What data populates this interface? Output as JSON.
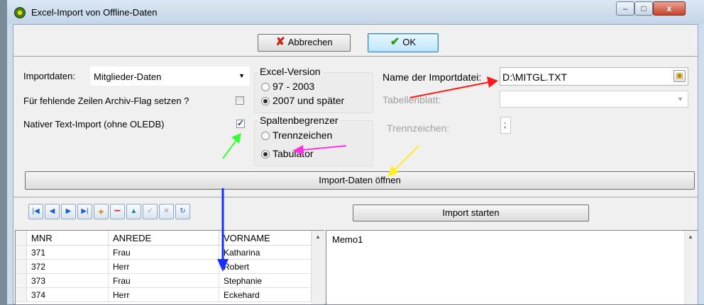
{
  "window": {
    "title": "Excel-Import von Offline-Daten",
    "minimize": "–",
    "maximize": "□",
    "close": "x"
  },
  "toolbar": {
    "cancel_label": "Abbrechen",
    "ok_label": "OK"
  },
  "import": {
    "label": "Importdaten:",
    "selected": "Mitglieder-Daten",
    "archive_flag_label": "Für fehlende Zeilen Archiv-Flag setzen ?",
    "archive_flag_checked": false,
    "native_import_label": "Nativer Text-Import (ohne OLEDB)",
    "native_import_checked": true
  },
  "excel_version": {
    "title": "Excel-Version",
    "options": [
      "97 - 2003",
      "2007 und später"
    ],
    "selected_index": 1
  },
  "separator_group": {
    "title": "Spaltenbegrenzer",
    "options": [
      "Trennzeichen",
      "Tabulator"
    ],
    "selected_index": 1
  },
  "file": {
    "name_label": "Name der Importdatei:",
    "name_value": "D:\\MITGL.TXT",
    "sheet_label": "Tabellenblatt:",
    "sheet_value": "",
    "separator_label": "Trennzeichen:",
    "separator_value": ";"
  },
  "open_button": "Import-Daten öffnen",
  "start_button": "Import starten",
  "navigator": [
    "first-icon",
    "prior-icon",
    "next-icon",
    "last-icon",
    "insert-icon",
    "delete-icon",
    "edit-icon",
    "post-icon",
    "cancel-icon",
    "refresh-icon"
  ],
  "grid": {
    "columns": [
      "MNR",
      "ANREDE",
      "VORNAME"
    ],
    "rows": [
      [
        "371",
        "Frau",
        "Katharina"
      ],
      [
        "372",
        "Herr",
        "Robert"
      ],
      [
        "373",
        "Frau",
        "Stephanie"
      ],
      [
        "374",
        "Herr",
        "Eckehard"
      ]
    ]
  },
  "memo": {
    "text": "Memo1"
  },
  "colors": {
    "red_arrow": "#ff1a1a",
    "green_arrow": "#33ff33",
    "magenta_arrow": "#ff33dd",
    "yellow_arrow": "#ffee22",
    "blue_arrow": "#1a2eff"
  }
}
